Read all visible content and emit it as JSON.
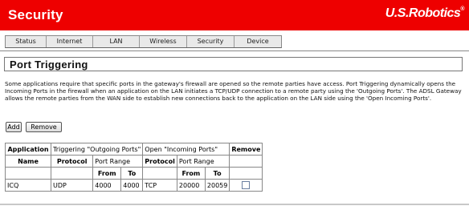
{
  "header": {
    "title": "Security",
    "logo": "U.S.Robotics",
    "logo_reg": "®"
  },
  "tabs": [
    {
      "label": "Status"
    },
    {
      "label": "Internet"
    },
    {
      "label": "LAN"
    },
    {
      "label": "Wireless"
    },
    {
      "label": "Security"
    },
    {
      "label": "Device"
    }
  ],
  "section": {
    "title": "Port Triggering"
  },
  "description": "Some applications require that specific ports in the gateway's firewall are opened so the remote parties have access. Port Triggering dynamically opens the Incoming Ports in the firewall when an application on the LAN initiates a TCP/UDP connection to a remote party using the 'Outgoing Ports'. The ADSL Gateway allows the remote parties from the WAN side to establish new connections back to the application on the LAN side using the 'Open Incoming Ports'.",
  "buttons": {
    "add": "Add",
    "remove": "Remove"
  },
  "table": {
    "h_application": "Application",
    "h_triggering": "Triggering \"Outgoing Ports\"",
    "h_open": "Open \"Incoming Ports\"",
    "h_remove": "Remove",
    "h_name": "Name",
    "h_protocol": "Protocol",
    "h_port_range": "Port Range",
    "h_from": "From",
    "h_to": "To",
    "rows": [
      {
        "name": "ICQ",
        "t_protocol": "UDP",
        "t_from": "4000",
        "t_to": "4000",
        "o_protocol": "TCP",
        "o_from": "20000",
        "o_to": "20059"
      }
    ]
  },
  "colors": {
    "header": "#ee0000"
  }
}
